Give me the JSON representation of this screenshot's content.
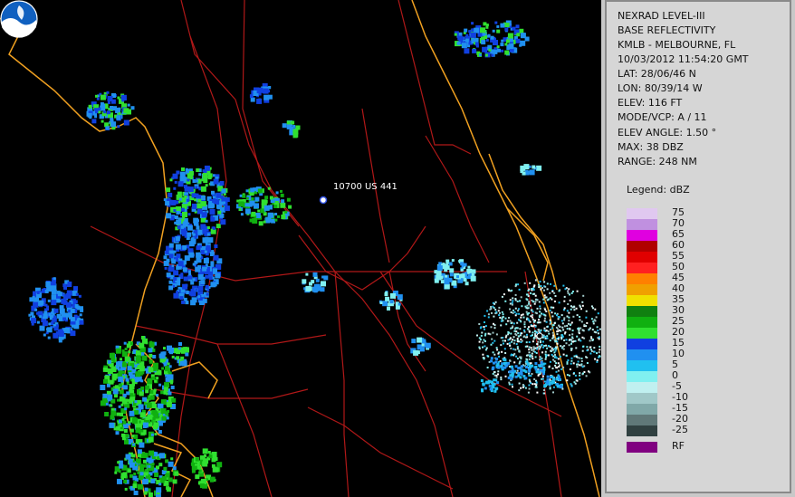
{
  "info_lines": [
    "NEXRAD LEVEL-III",
    "BASE REFLECTIVITY",
    "KMLB - MELBOURNE, FL",
    "10/03/2012 11:54:20 GMT",
    "LAT: 28/06/46 N",
    "LON: 80/39/14 W",
    "ELEV: 116 FT",
    "MODE/VCP: A / 11"
  ],
  "info_lines2": [
    "ELEV ANGLE: 1.50 °",
    "MAX: 38 DBZ",
    "RANGE: 248 NM"
  ],
  "legend_title": "Legend: dBZ",
  "legend": [
    {
      "label": "75",
      "color": "#e0c8f0"
    },
    {
      "label": "70",
      "color": "#c090e0"
    },
    {
      "label": "65",
      "color": "#e000e0"
    },
    {
      "label": "60",
      "color": "#b00000"
    },
    {
      "label": "55",
      "color": "#e00000"
    },
    {
      "label": "50",
      "color": "#ff2020"
    },
    {
      "label": "45",
      "color": "#ff8000"
    },
    {
      "label": "40",
      "color": "#f0a000"
    },
    {
      "label": "35",
      "color": "#f0e000"
    },
    {
      "label": "30",
      "color": "#108010"
    },
    {
      "label": "25",
      "color": "#10b010"
    },
    {
      "label": "20",
      "color": "#30e030"
    },
    {
      "label": "15",
      "color": "#1040e0"
    },
    {
      "label": "10",
      "color": "#2090f0"
    },
    {
      "label": "5",
      "color": "#20c0f0"
    },
    {
      "label": "0",
      "color": "#80f0f0"
    },
    {
      "label": "-5",
      "color": "#c0f0f0"
    },
    {
      "label": "-10",
      "color": "#a0c8c8"
    },
    {
      "label": "-15",
      "color": "#80a8a8"
    },
    {
      "label": "-20",
      "color": "#607878"
    },
    {
      "label": "-25",
      "color": "#304040"
    }
  ],
  "rf_label": "RF",
  "rf_color": "#800080",
  "place_label": "10700 US 441",
  "logo_text": "NOAA",
  "colors": {
    "coast": "#f0a020",
    "roads": "#c02020",
    "background": "#000000"
  }
}
